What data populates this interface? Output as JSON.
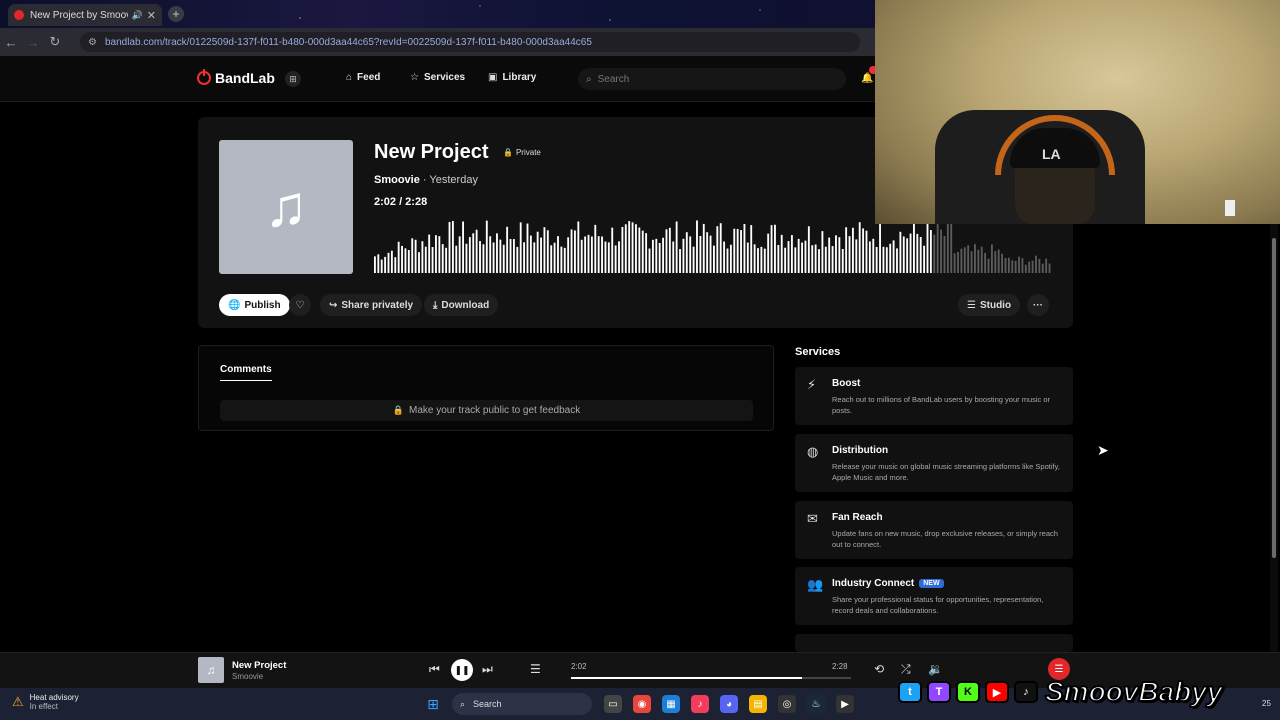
{
  "browser": {
    "tab_title": "New Project by Smoovie | B",
    "close_glyph": "✕",
    "new_tab_glyph": "+",
    "back_glyph": "←",
    "forward_glyph": "→",
    "reload_glyph": "↻",
    "url": "bandlab.com/track/0122509d-137f-f011-b480-000d3aa44c65?revId=0022509d-137f-f011-b480-000d3aa44c65"
  },
  "header": {
    "logo": "BandLab",
    "nav": [
      {
        "label": "Feed",
        "icon": "home-icon"
      },
      {
        "label": "Services",
        "icon": "star-icon"
      },
      {
        "label": "Library",
        "icon": "library-icon"
      }
    ],
    "search_placeholder": "Search"
  },
  "track": {
    "title": "New Project",
    "privacy": "Private",
    "artist": "Smoovie",
    "posted": " · Yesterday",
    "time": "2:02 /  2:28",
    "progress_fraction": 0.824,
    "actions": {
      "publish": "Publish",
      "share": "Share privately",
      "download": "Download",
      "studio": "Studio",
      "more": "···"
    }
  },
  "comments": {
    "tab": "Comments",
    "note": "Make your track public to get feedback"
  },
  "services": {
    "title": "Services",
    "items": [
      {
        "name": "Boost",
        "badge": "",
        "icon": "bolt-icon",
        "desc": "Reach out to millions of BandLab users by boosting your music or posts."
      },
      {
        "name": "Distribution",
        "badge": "",
        "icon": "globe-icon",
        "desc": "Release your music on global music streaming platforms like Spotify, Apple Music and more."
      },
      {
        "name": "Fan Reach",
        "badge": "",
        "icon": "mail-icon",
        "desc": "Update fans on new music, drop exclusive releases, or simply reach out to connect."
      },
      {
        "name": "Industry Connect",
        "badge": "NEW",
        "icon": "people-icon",
        "desc": "Share your professional status for opportunities, representation, record deals and collaborations."
      }
    ]
  },
  "player": {
    "title": "New Project",
    "artist": "Smoovie",
    "elapsed": "2:02",
    "total": "2:28",
    "progress_fraction": 0.824
  },
  "taskbar": {
    "weather_title": "Heat advisory",
    "weather_sub": "In effect",
    "search": "Search",
    "clock": "25"
  },
  "overlay": {
    "handle": "SmoovBabyy",
    "cap_logo": "LA"
  },
  "colors": {
    "accent": "#f0302f",
    "played": "#ffffff",
    "unplayed": "#5c5c5c",
    "badge": "#2f6cd8"
  }
}
